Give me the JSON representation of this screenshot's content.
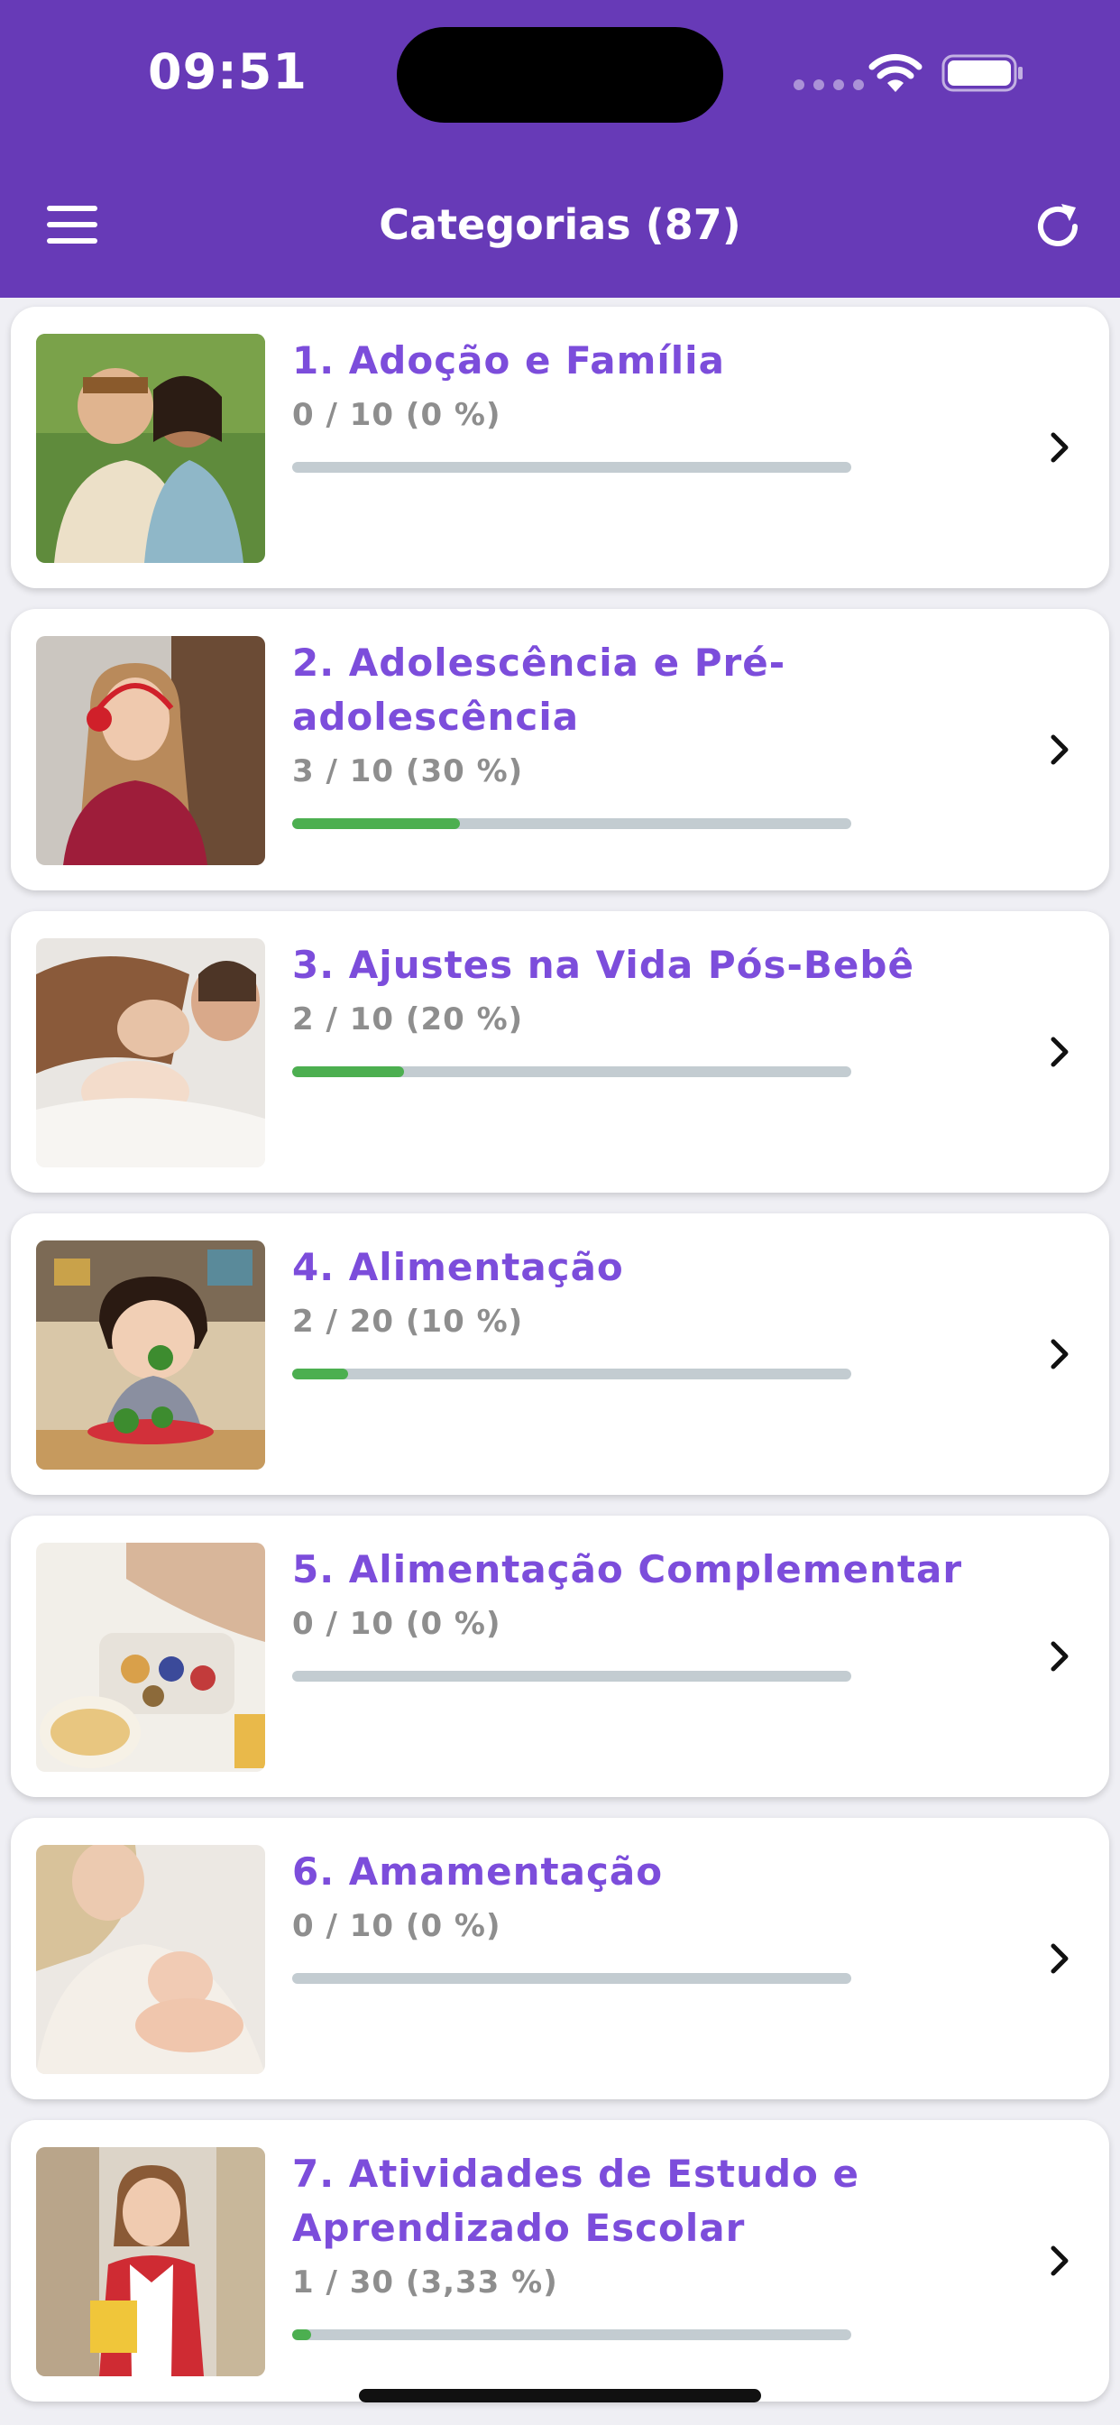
{
  "status_bar": {
    "time": "09:51"
  },
  "header": {
    "title": "Categorias (87)",
    "menu_icon": "hamburger-menu-icon",
    "refresh_icon": "refresh-icon"
  },
  "colors": {
    "primary": "#673ab7",
    "title_accent": "#7c4ddb",
    "progress_fill": "#4caf50",
    "progress_track": "#c3ccd1"
  },
  "categories": [
    {
      "title": "1. Adoção e Família",
      "progress_text": "0 / 10 (0 %)",
      "progress": 0.0,
      "image": "father-and-daughter-photo"
    },
    {
      "title": "2. Adolescência e Pré-adolescência",
      "progress_text": "3 / 10 (30 %)",
      "progress": 0.3,
      "image": "teen-with-headphones-photo"
    },
    {
      "title": "3. Ajustes na Vida Pós-Bebê",
      "progress_text": "2 / 10 (20 %)",
      "progress": 0.2,
      "image": "parents-with-baby-photo"
    },
    {
      "title": "4. Alimentação",
      "progress_text": "2 / 20 (10 %)",
      "progress": 0.1,
      "image": "toddler-eating-broccoli-photo"
    },
    {
      "title": "5. Alimentação Complementar",
      "progress_text": "0 / 10 (0 %)",
      "progress": 0.0,
      "image": "baby-food-plate-photo"
    },
    {
      "title": "6. Amamentação",
      "progress_text": "0 / 10 (0 %)",
      "progress": 0.0,
      "image": "breastfeeding-photo"
    },
    {
      "title": "7. Atividades de Estudo e Aprendizado Escolar",
      "progress_text": "1 / 30 (3,33 %)",
      "progress": 0.0333,
      "image": "schoolgirl-with-backpack-photo"
    }
  ]
}
